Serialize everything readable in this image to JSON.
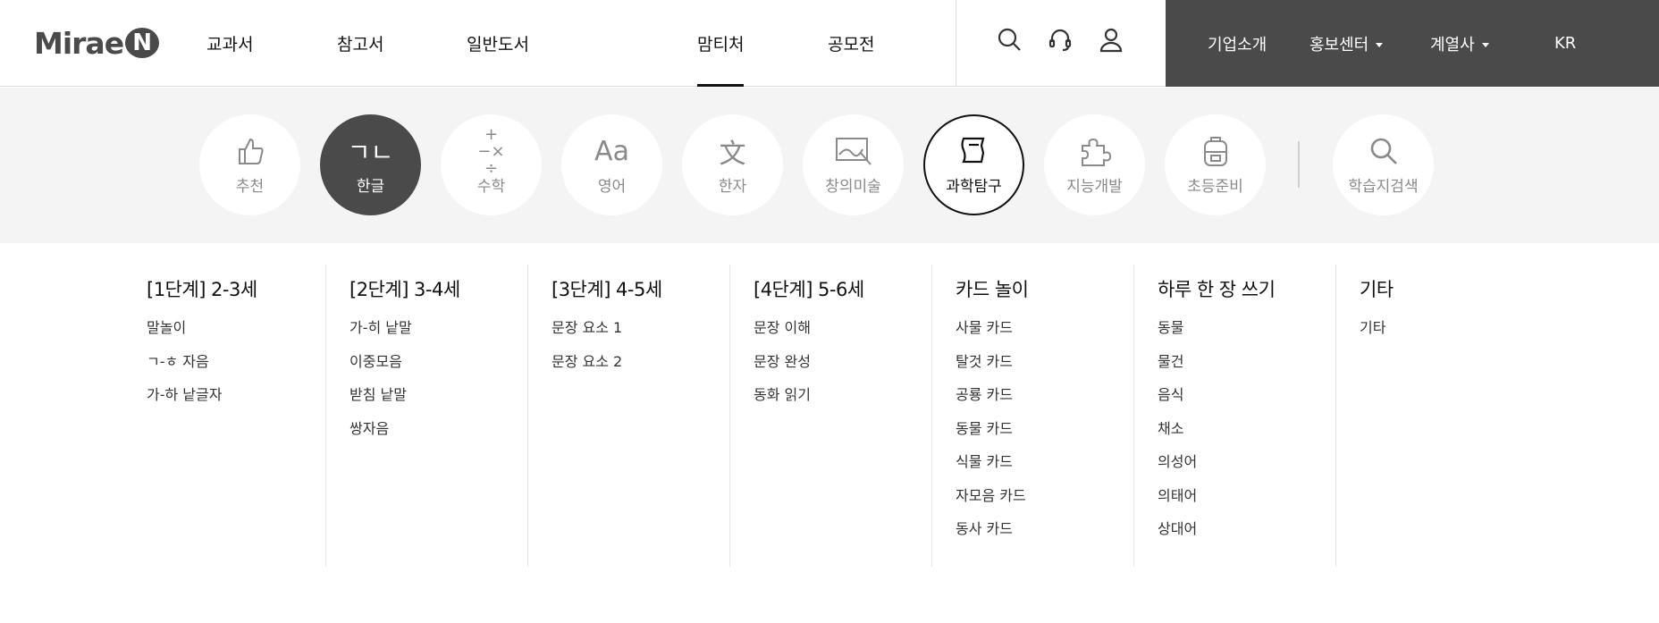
{
  "logo": {
    "text": "Mirae",
    "badge": "N"
  },
  "nav": [
    {
      "label": "교과서"
    },
    {
      "label": "참고서"
    },
    {
      "label": "일반도서"
    },
    {
      "label": "맘티처",
      "active": true
    },
    {
      "label": "공모전"
    }
  ],
  "header_icons": [
    "search-icon",
    "headset-icon",
    "user-icon"
  ],
  "right_menu": [
    {
      "label": "기업소개"
    },
    {
      "label": "홍보센터"
    },
    {
      "label": "계열사"
    },
    {
      "label": "KR"
    }
  ],
  "categories": [
    {
      "label": "추천",
      "icon": "thumbs-up-icon"
    },
    {
      "label": "한글",
      "icon": "hangul-icon",
      "glyph": "ㄱㄴ",
      "state": "active"
    },
    {
      "label": "수학",
      "icon": "math-icon",
      "glyph": "+−×÷"
    },
    {
      "label": "영어",
      "icon": "english-icon",
      "glyph": "Aa"
    },
    {
      "label": "한자",
      "icon": "hanja-icon",
      "glyph": "文"
    },
    {
      "label": "창의미술",
      "icon": "art-icon"
    },
    {
      "label": "과학탐구",
      "icon": "science-icon",
      "state": "outlined"
    },
    {
      "label": "지능개발",
      "icon": "puzzle-icon"
    },
    {
      "label": "초등준비",
      "icon": "backpack-icon"
    },
    {
      "label": "학습지검색",
      "icon": "search-icon"
    }
  ],
  "columns": [
    {
      "title": "[1단계] 2-3세",
      "items": [
        "말놀이",
        "ㄱ-ㅎ 자음",
        "가-하 낱글자"
      ]
    },
    {
      "title": "[2단계] 3-4세",
      "items": [
        "가-히 낱말",
        "이중모음",
        "받침 낱말",
        "쌍자음"
      ]
    },
    {
      "title": "[3단계] 4-5세",
      "items": [
        "문장 요소 1",
        "문장 요소 2"
      ]
    },
    {
      "title": "[4단계] 5-6세",
      "items": [
        "문장 이해",
        "문장 완성",
        "동화 읽기"
      ]
    },
    {
      "title": "카드 놀이",
      "items": [
        "사물 카드",
        "탈것 카드",
        "공룡 카드",
        "동물 카드",
        "식물 카드",
        "자모음 카드",
        "동사 카드"
      ]
    },
    {
      "title": "하루 한 장 쓰기",
      "items": [
        "동물",
        "물건",
        "음식",
        "채소",
        "의성어",
        "의태어",
        "상대어"
      ]
    },
    {
      "title": "기타",
      "items": [
        "기타"
      ]
    }
  ]
}
